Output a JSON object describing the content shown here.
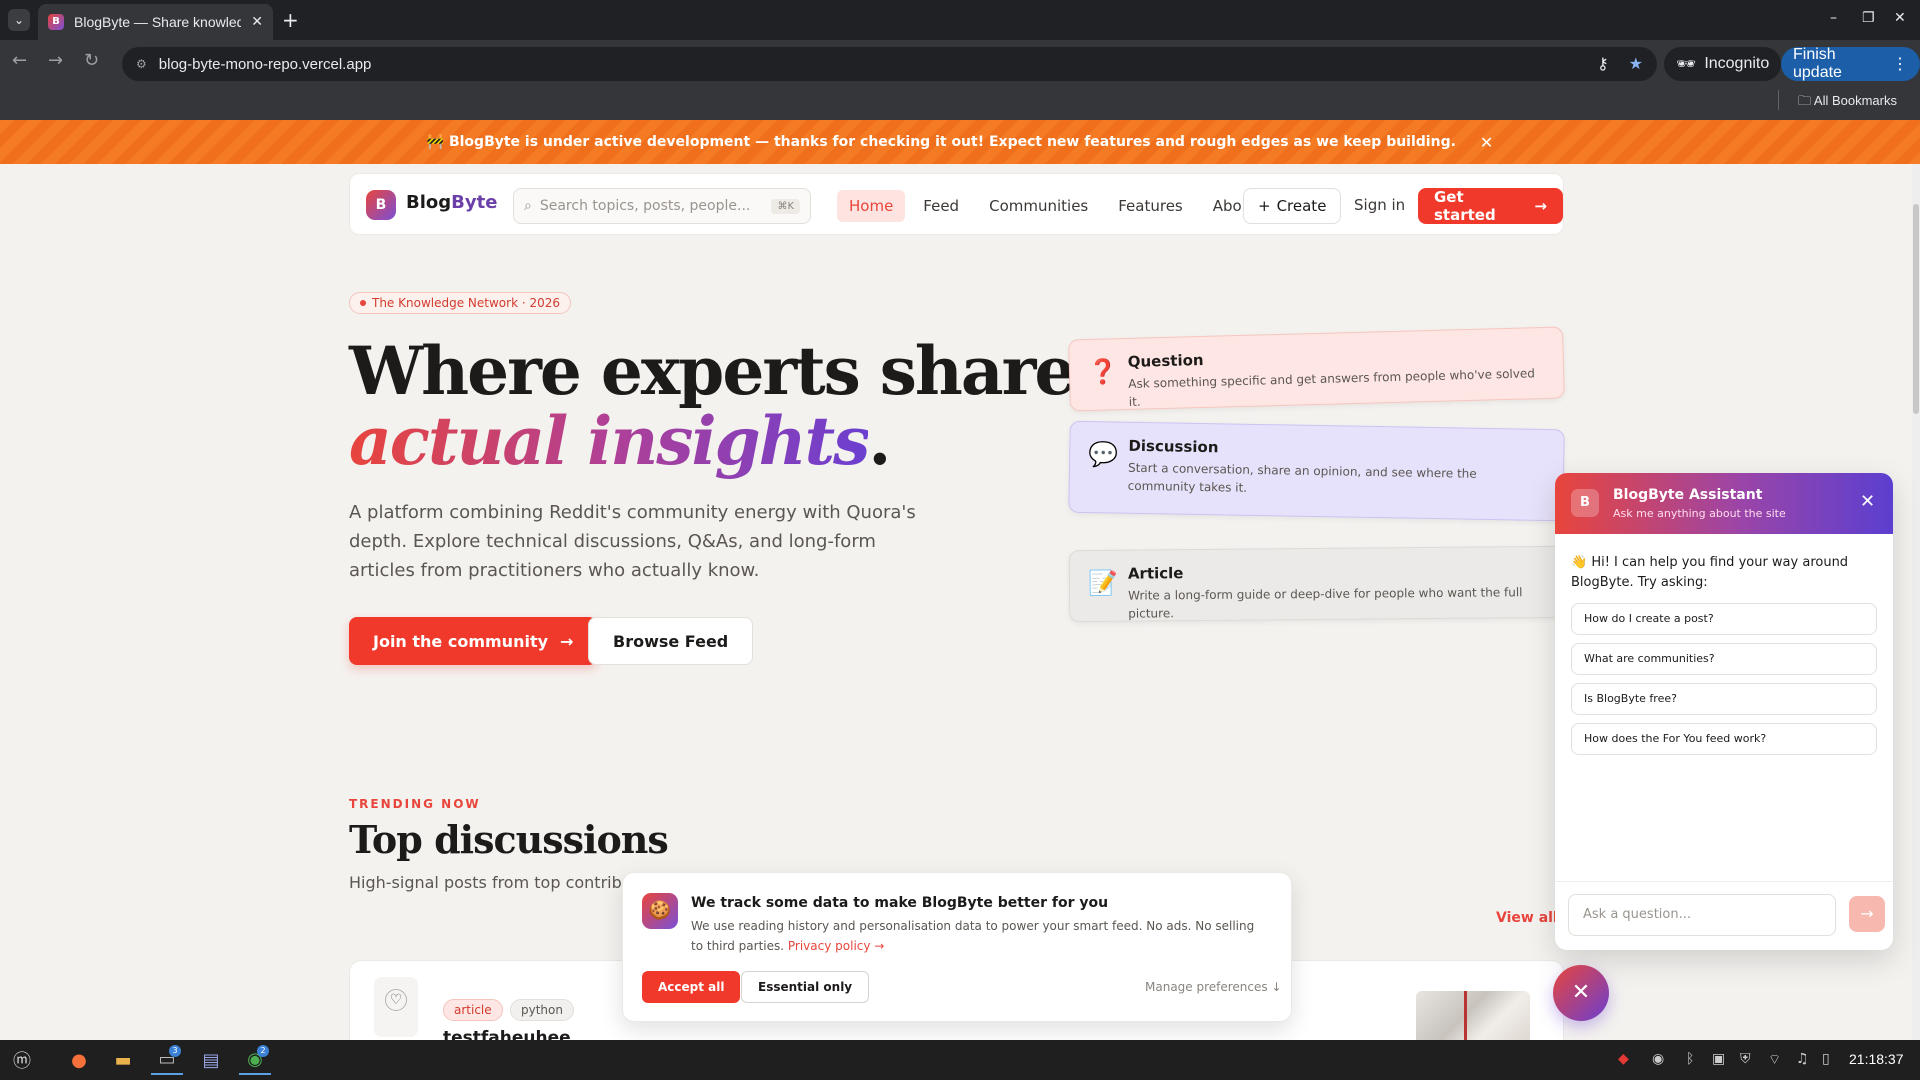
{
  "browser": {
    "tab_title": "BlogByte — Share knowledg",
    "tab_favicon": "B",
    "url": "blog-byte-mono-repo.vercel.app",
    "incognito_label": "Incognito",
    "finish_update_label": "Finish update",
    "bookmarks_label": "All Bookmarks"
  },
  "banner": {
    "text": "🚧 BlogByte is under active development — thanks for checking it out! Expect new features and rough edges as we keep building."
  },
  "nav": {
    "logo_badge": "B",
    "logo_blog": "Blog",
    "logo_byte": "Byte",
    "search_placeholder": "Search topics, posts, people...",
    "search_shortcut": "⌘K",
    "links": [
      "Home",
      "Feed",
      "Communities",
      "Features",
      "About"
    ],
    "active_link": "Home",
    "create_label": "Create",
    "signin_label": "Sign in",
    "getstarted_label": "Get started"
  },
  "hero": {
    "pill": "The Knowledge Network · 2026",
    "title_line1": "Where experts share",
    "title_line2": "actual insights",
    "title_dot": ".",
    "lede": "A platform combining Reddit's community energy with Quora's depth. Explore technical discussions, Q&As, and long-form articles from practitioners who actually know.",
    "join_label": "Join the community",
    "browse_label": "Browse Feed"
  },
  "cards": [
    {
      "icon": "❓",
      "title": "Question",
      "desc": "Ask something specific and get answers from people who've solved it."
    },
    {
      "icon": "💬",
      "title": "Discussion",
      "desc": "Start a conversation, share an opinion, and see where the community takes it."
    },
    {
      "icon": "📝",
      "title": "Article",
      "desc": "Write a long-form guide or deep-dive for people who want the full picture."
    }
  ],
  "trending": {
    "eyebrow": "TRENDING NOW",
    "title": "Top discussions",
    "subtitle": "High-signal posts from top contributors",
    "view_all": "View all"
  },
  "post": {
    "tags": [
      "article",
      "python"
    ],
    "title": "testfaheuhee"
  },
  "cookie": {
    "icon": "🍪",
    "title": "We track some data to make BlogByte better for you",
    "text": "We use reading history and personalisation data to power your smart feed. No ads. No selling to third parties.",
    "link": "Privacy policy →",
    "accept": "Accept all",
    "essential": "Essential only",
    "manage": "Manage preferences ↓"
  },
  "chat": {
    "avatar": "B",
    "title": "BlogByte Assistant",
    "subtitle": "Ask me anything about the site",
    "greeting": "👋 Hi! I can help you find your way around BlogByte. Try asking:",
    "suggestions": [
      "How do I create a post?",
      "What are communities?",
      "Is BlogByte free?",
      "How does the For You feed work?"
    ],
    "input_placeholder": "Ask a question..."
  },
  "taskbar": {
    "clock": "21:18:37",
    "terminal_badge": "3",
    "chrome_badge": "2"
  },
  "colors": {
    "accent": "#f0392b",
    "purple": "#6b3fd0",
    "banner": "#f47a23"
  }
}
